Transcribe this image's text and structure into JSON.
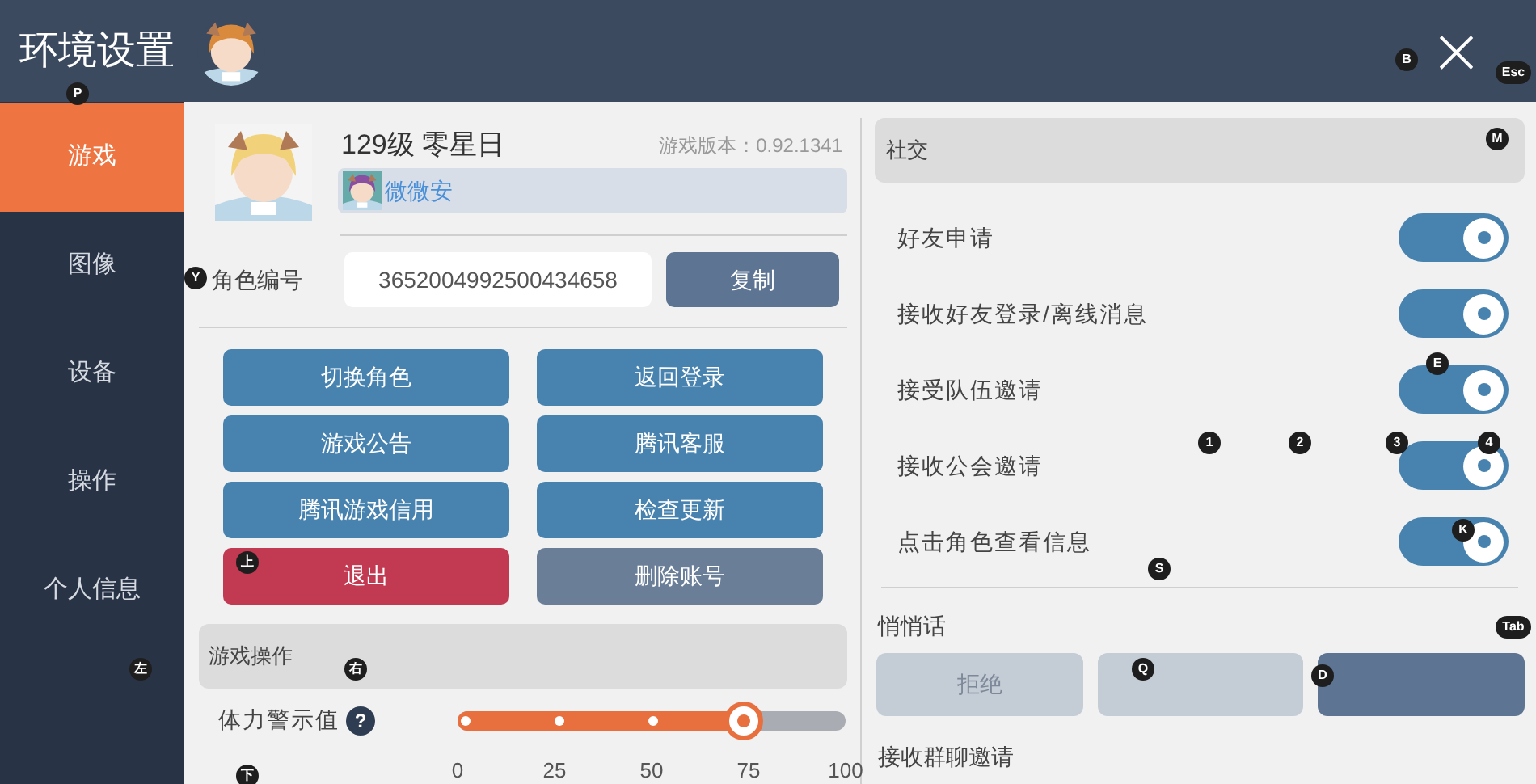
{
  "window": {
    "title": "环境设置",
    "close": "×"
  },
  "sidebar": {
    "items": [
      {
        "label": "游戏",
        "selected": true
      },
      {
        "label": "图像",
        "selected": false
      },
      {
        "label": "设备",
        "selected": false
      },
      {
        "label": "操作",
        "selected": false
      },
      {
        "label": "个人信息",
        "selected": false
      }
    ]
  },
  "profile": {
    "name": "129级 零星日",
    "version": "游戏版本：0.92.1341",
    "guild": "微微安",
    "id_label": "角色编号",
    "id_value": "3652004992500434658",
    "copy": "复制"
  },
  "actions": [
    {
      "label": "切换角色",
      "kind": "primary"
    },
    {
      "label": "返回登录",
      "kind": "primary"
    },
    {
      "label": "游戏公告",
      "kind": "primary"
    },
    {
      "label": "腾讯客服",
      "kind": "primary"
    },
    {
      "label": "腾讯游戏信用",
      "kind": "primary"
    },
    {
      "label": "检查更新",
      "kind": "primary"
    },
    {
      "label": "退出",
      "kind": "danger"
    },
    {
      "label": "删除账号",
      "kind": "muted"
    }
  ],
  "game_ops": {
    "title": "游戏操作",
    "stamina": {
      "label": "体力警示值",
      "help": "?",
      "level": 0.75,
      "ticks": [
        "0",
        "25",
        "50",
        "75",
        "100"
      ]
    }
  },
  "social": {
    "title": "社交",
    "toggles": [
      {
        "label": "好友申请",
        "on": true
      },
      {
        "label": "接收好友登录/离线消息",
        "on": true
      },
      {
        "label": "接受队伍邀请",
        "on": true
      },
      {
        "label": "接收公会邀请",
        "on": true
      },
      {
        "label": "点击角色查看信息",
        "on": true
      }
    ],
    "whisper": {
      "title": "悄悄话",
      "options": [
        {
          "label": "拒绝",
          "selected": false
        },
        {
          "selected": false
        },
        {
          "selected": true
        }
      ]
    },
    "group_chat": {
      "title": "接收群聊邀请"
    }
  },
  "key_hints": [
    "P",
    "B",
    "Esc",
    "M",
    "Y",
    "E",
    "1",
    "2",
    "3",
    "4",
    "K",
    "S",
    "上",
    "Tab",
    "左",
    "右",
    "下",
    "Q",
    "D"
  ]
}
